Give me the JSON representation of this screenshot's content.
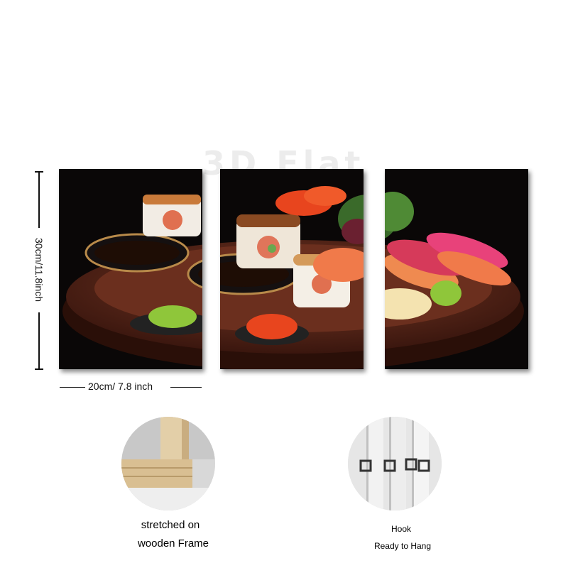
{
  "watermark": "3D Flat",
  "dimensions": {
    "height_label": "30cm/11.8inch",
    "width_label": "20cm/ 7.8 inch"
  },
  "features": [
    {
      "icon": "wooden-frame-icon",
      "caption_line1": "stretched on",
      "caption_line2": "wooden Frame"
    },
    {
      "icon": "hook-icon",
      "caption_line1": "Hook",
      "caption_line2": "Ready to Hang"
    }
  ],
  "colors": {
    "panel_bg": "#0a0707",
    "board": "#5a2a1c",
    "salmon": "#f07a4a",
    "tuna": "#d63a5a",
    "wasabi": "#8fc63a",
    "roe": "#e8451e"
  }
}
